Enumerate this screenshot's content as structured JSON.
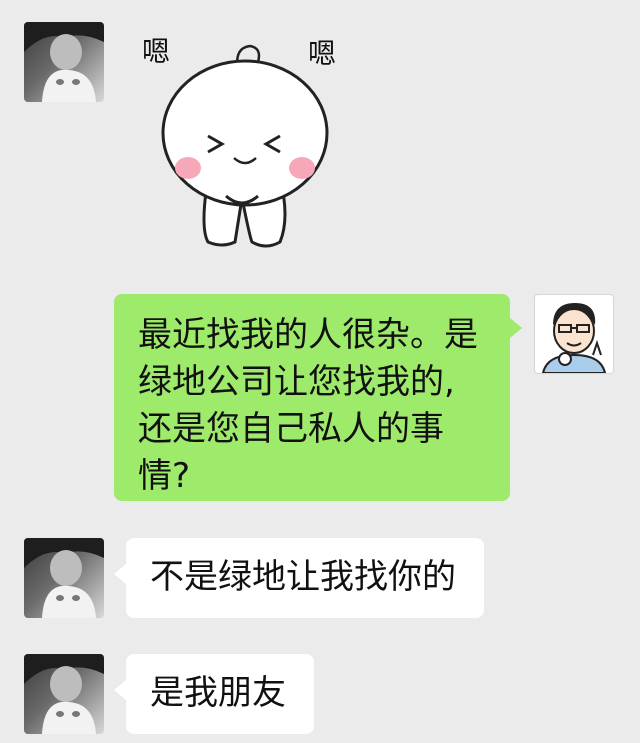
{
  "chat": {
    "messages": [
      {
        "sender": "other",
        "type": "sticker",
        "caption_left": "嗯",
        "caption_right": "嗯"
      },
      {
        "sender": "self",
        "type": "text",
        "lines": [
          "最近找我的人很杂。是",
          "绿地公司让您找我的,",
          "还是您自己私人的事",
          "情?"
        ]
      },
      {
        "sender": "other",
        "type": "text",
        "text": "不是绿地让我找你的"
      },
      {
        "sender": "other",
        "type": "text",
        "text": "是我朋友"
      }
    ]
  },
  "colors": {
    "background": "#ebebeb",
    "bubble_self": "#9eea6a",
    "bubble_other": "#ffffff"
  },
  "icons": {
    "avatar_other": "girl-with-white-cat-avatar",
    "avatar_self": "cartoon-man-avatar"
  }
}
